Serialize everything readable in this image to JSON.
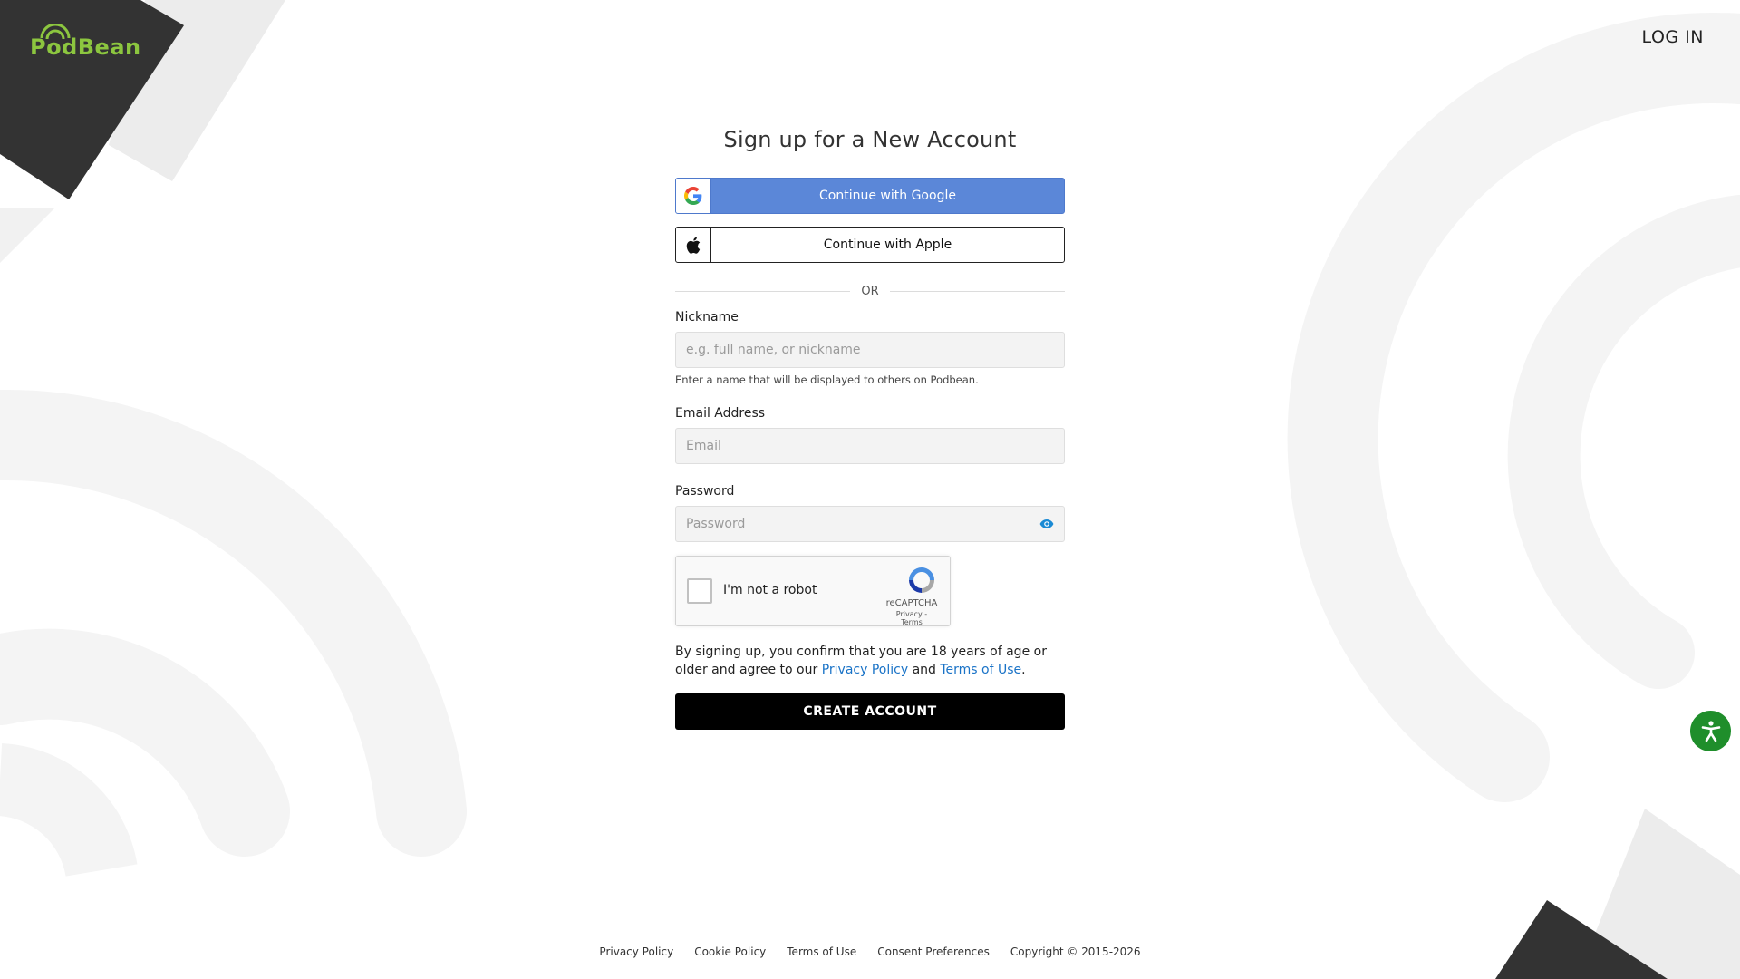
{
  "header": {
    "logo_text": "PodBean",
    "login_label": "LOG IN"
  },
  "form": {
    "title": "Sign up for a New Account",
    "google_label": "Continue with Google",
    "apple_label": "Continue with Apple",
    "or_label": "OR",
    "nickname": {
      "label": "Nickname",
      "placeholder": "e.g. full name, or nickname",
      "hint": "Enter a name that will be displayed to others on Podbean."
    },
    "email": {
      "label": "Email Address",
      "placeholder": "Email"
    },
    "password": {
      "label": "Password",
      "placeholder": "Password"
    },
    "recaptcha": {
      "label": "I'm not a robot",
      "brand": "reCAPTCHA",
      "privacy": "Privacy",
      "separator": " - ",
      "terms": "Terms"
    },
    "agree": {
      "prefix": "By signing up, you confirm that you are 18 years of age or older and agree to our ",
      "privacy_link": "Privacy Policy",
      "and": " and ",
      "terms_link": "Terms of Use",
      "suffix": "."
    },
    "create_label": "CREATE ACCOUNT"
  },
  "footer": {
    "links": [
      "Privacy Policy",
      "Cookie Policy",
      "Terms of Use",
      "Consent Preferences"
    ],
    "copyright": "Copyright © 2015-2026"
  },
  "colors": {
    "brand_green": "#8cc63f",
    "google_blue": "#5b87d8",
    "link_blue": "#1a73c7",
    "accessibility_green": "#1f8e2b"
  },
  "icons": [
    "google-icon",
    "apple-icon",
    "eye-icon",
    "recaptcha-icon",
    "accessibility-icon"
  ]
}
